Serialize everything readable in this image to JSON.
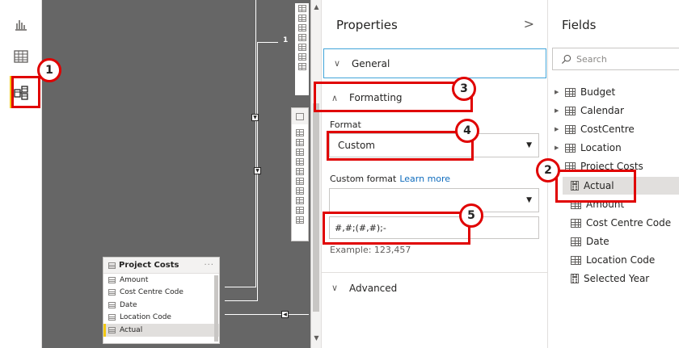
{
  "rail": {
    "icons": [
      "report-view-icon",
      "data-view-icon",
      "model-view-icon"
    ]
  },
  "canvas": {
    "relationship_label": "1",
    "table_card": {
      "title": "Project Costs",
      "menu": "···",
      "fields": [
        "Amount",
        "Cost Centre Code",
        "Date",
        "Location Code",
        "Actual"
      ]
    }
  },
  "properties": {
    "title": "Properties",
    "collapse_glyph": ">",
    "sections": {
      "general": "General",
      "formatting": "Formatting",
      "advanced": "Advanced"
    },
    "format_label": "Format",
    "format_value": "Custom",
    "custom_format_label": "Custom format",
    "learn_more": "Learn more",
    "custom_format_dropdown_value": "",
    "custom_format_input": "#,#;(#,#);-",
    "example": "Example: 123,457"
  },
  "fields": {
    "title": "Fields",
    "search_placeholder": "Search",
    "tables": [
      "Budget",
      "Calendar",
      "CostCentre",
      "Location",
      "Project Costs"
    ],
    "project_costs_fields": [
      "Actual",
      "Amount",
      "Cost Centre Code",
      "Date",
      "Location Code",
      "Selected Year"
    ]
  },
  "callouts": [
    "1",
    "2",
    "3",
    "4",
    "5"
  ],
  "colors": {
    "callout_red": "#e00000",
    "accent_yellow": "#f2c811",
    "canvas_gray": "#666666",
    "link_blue": "#0f6cbd",
    "focus_blue": "#41a5d9"
  }
}
